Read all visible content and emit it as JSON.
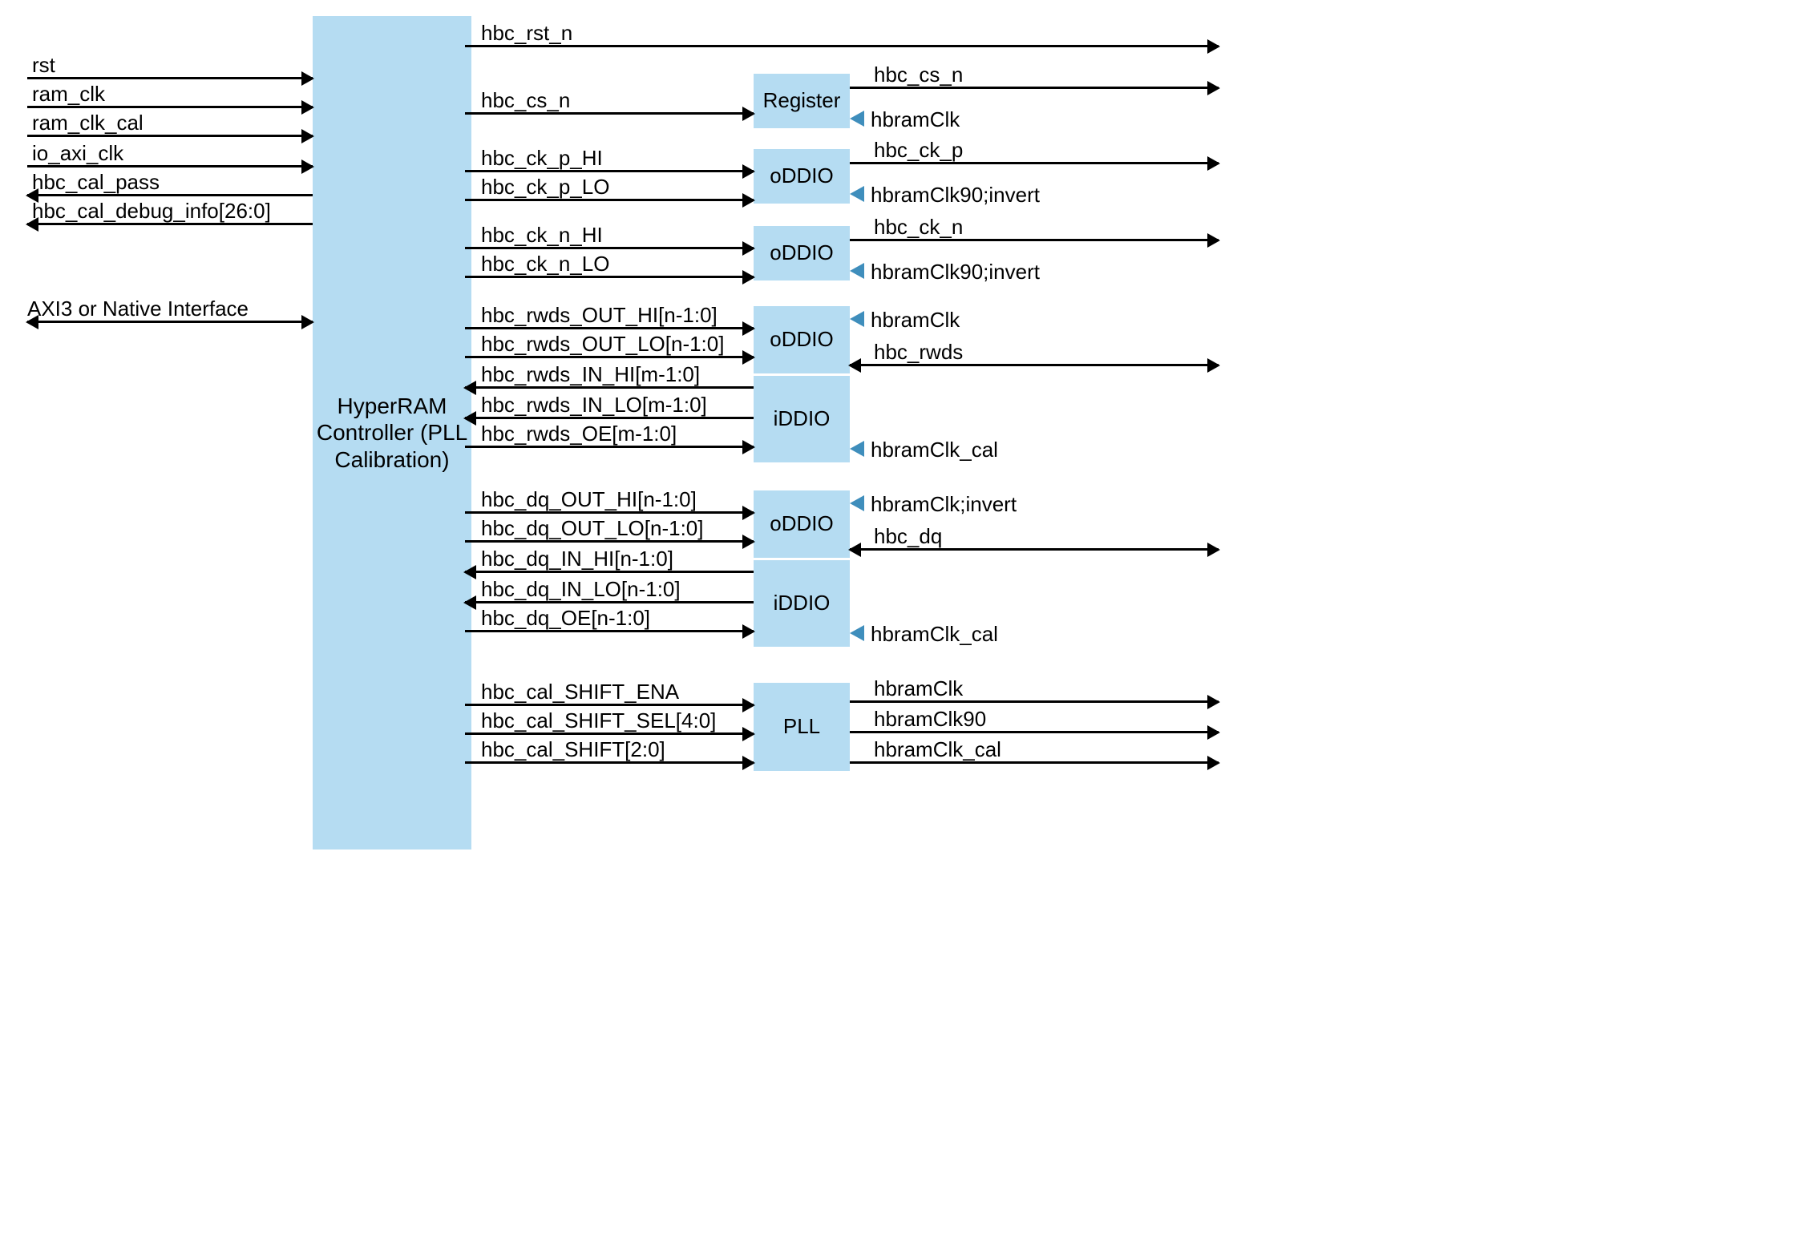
{
  "controller": {
    "label": "HyperRAM Controller (PLL Calibration)"
  },
  "leftSignals": {
    "rst": "rst",
    "ram_clk": "ram_clk",
    "ram_clk_cal": "ram_clk_cal",
    "io_axi_clk": "io_axi_clk",
    "hbc_cal_pass": "hbc_cal_pass",
    "hbc_cal_debug_info": "hbc_cal_debug_info[26:0]",
    "axi3": "AXI3 or Native Interface"
  },
  "ioBlocks": {
    "register": "Register",
    "oddio": "oDDIO",
    "iddio": "iDDIO",
    "pll": "PLL"
  },
  "midSignals": {
    "rst_n": "hbc_rst_n",
    "cs_n": "hbc_cs_n",
    "ck_p_hi": "hbc_ck_p_HI",
    "ck_p_lo": "hbc_ck_p_LO",
    "ck_n_hi": "hbc_ck_n_HI",
    "ck_n_lo": "hbc_ck_n_LO",
    "rwds_out_hi": "hbc_rwds_OUT_HI[n-1:0]",
    "rwds_out_lo": "hbc_rwds_OUT_LO[n-1:0]",
    "rwds_in_hi": "hbc_rwds_IN_HI[m-1:0]",
    "rwds_in_lo": "hbc_rwds_IN_LO[m-1:0]",
    "rwds_oe": "hbc_rwds_OE[m-1:0]",
    "dq_out_hi": "hbc_dq_OUT_HI[n-1:0]",
    "dq_out_lo": "hbc_dq_OUT_LO[n-1:0]",
    "dq_in_hi": "hbc_dq_IN_HI[n-1:0]",
    "dq_in_lo": "hbc_dq_IN_LO[n-1:0]",
    "dq_oe": "hbc_dq_OE[n-1:0]",
    "cal_shift_ena": "hbc_cal_SHIFT_ENA",
    "cal_shift_sel": "hbc_cal_SHIFT_SEL[4:0]",
    "cal_shift": "hbc_cal_SHIFT[2:0]"
  },
  "rightSignals": {
    "cs_n": "hbc_cs_n",
    "ck_p": "hbc_ck_p",
    "ck_n": "hbc_ck_n",
    "rwds": "hbc_rwds",
    "dq": "hbc_dq",
    "hbramClk": "hbramClk",
    "hbramClk90": "hbramClk90",
    "hbramClk_cal": "hbramClk_cal"
  },
  "clkLabels": {
    "hbramClk": "hbramClk",
    "hbramClk90inv": "hbramClk90;invert",
    "hbramClk_cal": "hbramClk_cal",
    "hbramClk_inv": "hbramClk;invert"
  }
}
